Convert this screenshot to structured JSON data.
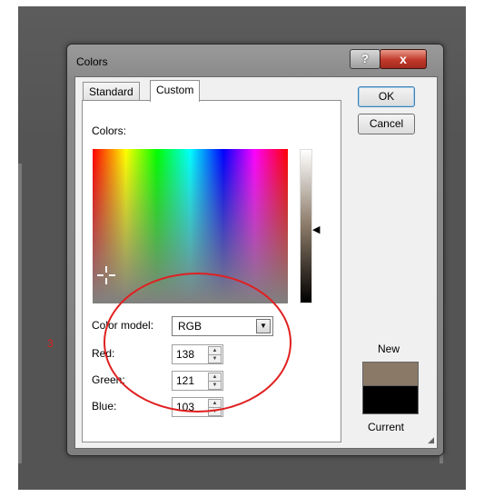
{
  "annotation": {
    "step_number": "3"
  },
  "dialog": {
    "title": "Colors",
    "help_label": "?",
    "close_label": "x",
    "tabs": [
      {
        "label": "Standard"
      },
      {
        "label": "Custom"
      }
    ],
    "colors_label": "Colors:",
    "ok_label": "OK",
    "cancel_label": "Cancel",
    "color_model": {
      "label": "Color model:",
      "value": "RGB"
    },
    "fields": [
      {
        "label": "Red:",
        "value": "138"
      },
      {
        "label": "Green:",
        "value": "121"
      },
      {
        "label": "Blue:",
        "value": "103"
      }
    ],
    "new_label": "New",
    "current_label": "Current",
    "colors": {
      "new_swatch": "#8a7967",
      "current_swatch": "#000000",
      "highlight_circle": "#e02020"
    }
  }
}
